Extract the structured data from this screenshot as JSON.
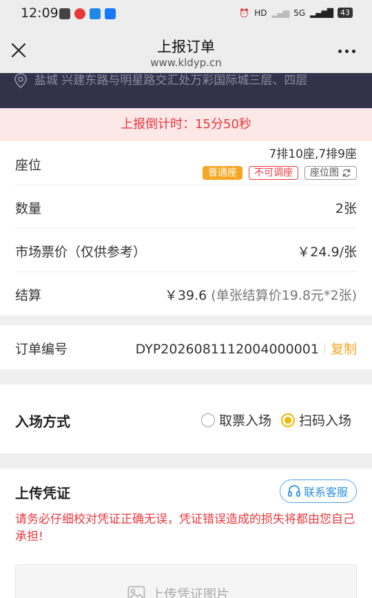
{
  "status_bar": {
    "time": "12:09",
    "network": "5G",
    "battery": "43"
  },
  "header": {
    "title": "上报订单",
    "url": "www.kldyp.cn"
  },
  "cinema": {
    "address": "盐城  兴建东路与明星路交汇处万彩国际城三层、四层"
  },
  "countdown": {
    "text": "上报倒计时：15分50秒"
  },
  "seat": {
    "label": "座位",
    "value": "7排10座,7排9座",
    "tags": {
      "ordinary": "普通座",
      "fixed": "不可调座",
      "seat_map": "座位图"
    }
  },
  "quantity": {
    "label": "数量",
    "value": "2张"
  },
  "market_price": {
    "label": "市场票价（仅供参考）",
    "value": "￥24.9/张"
  },
  "settlement": {
    "label": "结算",
    "value": "￥39.6",
    "detail": "(单张结算价19.8元*2张)"
  },
  "order": {
    "label": "订单编号",
    "number": "DYP2026081112004000001",
    "copy": "复制"
  },
  "entry": {
    "title": "入场方式",
    "options": [
      {
        "label": "取票入场",
        "selected": false
      },
      {
        "label": "扫码入场",
        "selected": true
      }
    ]
  },
  "upload": {
    "title": "上传凭证",
    "service_label": "联系客服",
    "warning": "请务必仔细校对凭证正确无误，凭证错误造成的损失将都由您自己承担!",
    "upload_label": "上传凭证图片"
  },
  "colors": {
    "accent": "#f5a623",
    "danger": "#e8383d",
    "link": "#2a8fe0",
    "dark_bg": "#34324a"
  }
}
